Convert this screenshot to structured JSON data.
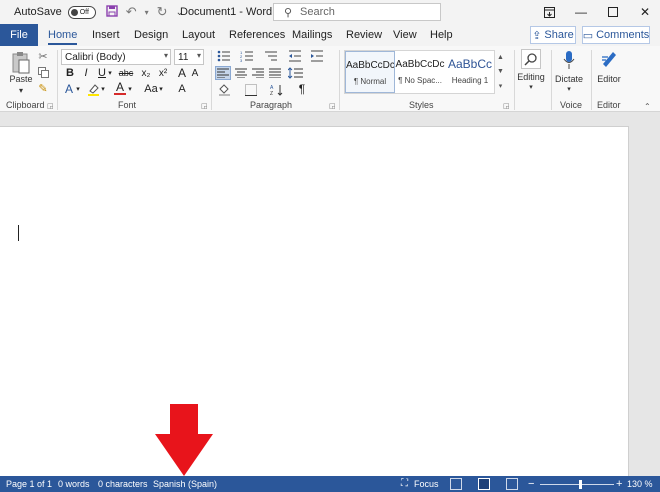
{
  "titlebar": {
    "autosave_label": "AutoSave",
    "autosave_state": "Off",
    "document_title": "Document1  -  Word",
    "search_placeholder": "Search"
  },
  "tabs": {
    "file": "File",
    "items": [
      {
        "label": "Home",
        "active": true
      },
      {
        "label": "Insert",
        "active": false
      },
      {
        "label": "Design",
        "active": false
      },
      {
        "label": "Layout",
        "active": false
      },
      {
        "label": "References",
        "active": false
      },
      {
        "label": "Mailings",
        "active": false
      },
      {
        "label": "Review",
        "active": false
      },
      {
        "label": "View",
        "active": false
      },
      {
        "label": "Help",
        "active": false
      }
    ],
    "share": "Share",
    "comments": "Comments"
  },
  "ribbon": {
    "clipboard": {
      "label": "Clipboard",
      "paste": "Paste"
    },
    "font": {
      "label": "Font",
      "font_name": "Calibri (Body)",
      "font_size": "11",
      "bold": "B",
      "italic": "I",
      "underline": "U",
      "strike": "abc",
      "subscript": "x₂",
      "superscript": "x²",
      "grow": "A",
      "shrink": "A",
      "change_case": "Aa",
      "clear": "A",
      "effects": "A",
      "font_color": "A"
    },
    "paragraph": {
      "label": "Paragraph",
      "show_marks": "¶"
    },
    "styles": {
      "label": "Styles",
      "items": [
        {
          "preview": "AaBbCcDc",
          "name": "¶ Normal"
        },
        {
          "preview": "AaBbCcDc",
          "name": "¶ No Spac..."
        },
        {
          "preview": "AaBbCc",
          "name": "Heading 1"
        }
      ]
    },
    "editing": {
      "label": "Editing"
    },
    "voice": {
      "label": "Voice",
      "dictate": "Dictate"
    },
    "editor": {
      "label": "Editor",
      "editor_btn": "Editor"
    }
  },
  "statusbar": {
    "page": "Page 1 of 1",
    "words": "0 words",
    "characters": "0 characters",
    "language": "Spanish (Spain)",
    "focus": "Focus",
    "zoom": "130 %",
    "zoom_minus": "−",
    "zoom_plus": "+"
  },
  "colors": {
    "accent": "#2b579a",
    "annotation_arrow": "#e8141b"
  }
}
